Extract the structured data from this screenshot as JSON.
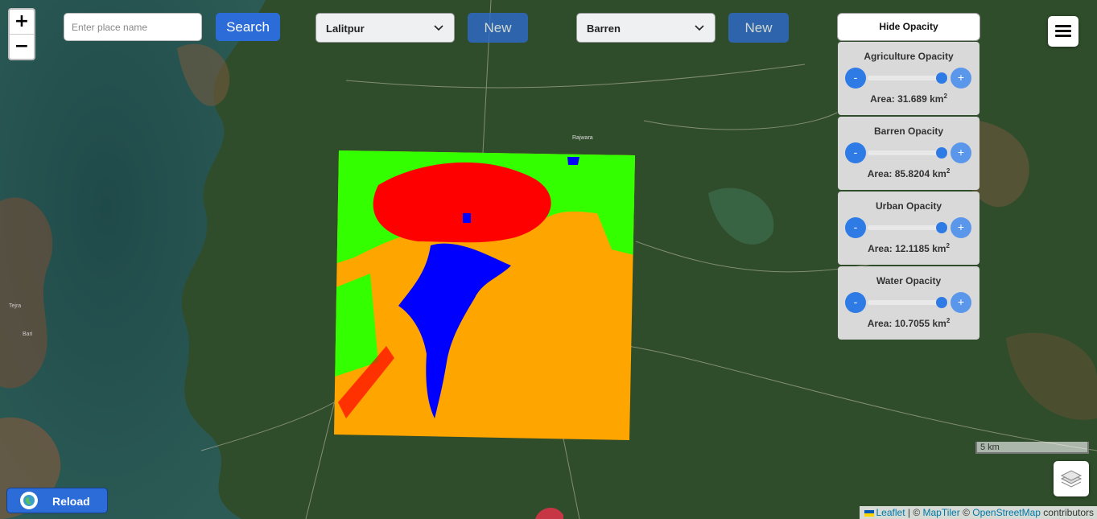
{
  "map": {
    "zoom_in_label": "+",
    "zoom_out_label": "−",
    "place_labels": [
      "Tejra",
      "Rajwara",
      "Bari"
    ],
    "scale_label": "5 km"
  },
  "search": {
    "placeholder": "Enter place name",
    "button_label": "Search"
  },
  "district_select": {
    "selected": "Lalitpur",
    "new_label": "New"
  },
  "class_select": {
    "selected": "Barren",
    "new_label": "New"
  },
  "opacity_toggle_label": "Hide Opacity",
  "opacity_panels": [
    {
      "title": "Agriculture Opacity",
      "minus": "-",
      "plus": "+",
      "level_percent": 92,
      "area_prefix": "Area: ",
      "area_value": "31.689",
      "area_unit": " km",
      "area_exp": "2"
    },
    {
      "title": "Barren Opacity",
      "minus": "-",
      "plus": "+",
      "level_percent": 92,
      "area_prefix": "Area: ",
      "area_value": "85.8204",
      "area_unit": " km",
      "area_exp": "2"
    },
    {
      "title": "Urban Opacity",
      "minus": "-",
      "plus": "+",
      "level_percent": 92,
      "area_prefix": "Area: ",
      "area_value": "12.1185",
      "area_unit": " km",
      "area_exp": "2"
    },
    {
      "title": "Water Opacity",
      "minus": "-",
      "plus": "+",
      "level_percent": 92,
      "area_prefix": "Area: ",
      "area_value": "10.7055",
      "area_unit": " km",
      "area_exp": "2"
    }
  ],
  "colors": {
    "agriculture": "#33ff00",
    "barren": "#ffa500",
    "urban": "#ff0000",
    "water": "#0000ff",
    "accent": "#2b6cd8"
  },
  "reload_label": "Reload",
  "attribution": {
    "leaflet": "Leaflet",
    "sep1": " | © ",
    "maptiler": "MapTiler",
    "sep2": " © ",
    "osm": "OpenStreetMap",
    "tail": " contributors"
  }
}
